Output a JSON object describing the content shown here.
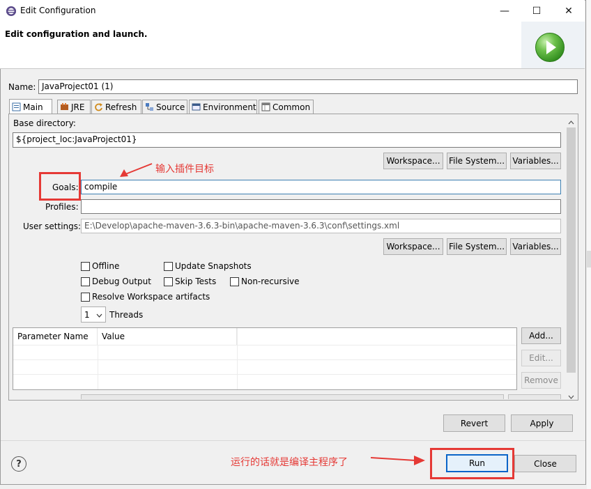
{
  "window": {
    "title": "Edit Configuration",
    "minimize_glyph": "—",
    "maximize_glyph": "☐",
    "close_glyph": "✕"
  },
  "header": {
    "title": "Edit configuration and launch.",
    "icon": "run-icon"
  },
  "name_field": {
    "label": "Name:",
    "value": "JavaProject01 (1)"
  },
  "tabs": [
    {
      "label": "Main",
      "icon": "main-tab-icon",
      "active": true
    },
    {
      "label": "JRE",
      "icon": "jre-icon"
    },
    {
      "label": "Refresh",
      "icon": "refresh-icon"
    },
    {
      "label": "Source",
      "icon": "source-icon"
    },
    {
      "label": "Environment",
      "icon": "environment-icon"
    },
    {
      "label": "Common",
      "icon": "common-icon"
    }
  ],
  "main": {
    "base_directory_label": "Base directory:",
    "base_directory_value": "${project_loc:JavaProject01}",
    "buttons_row1": [
      "Workspace...",
      "File System...",
      "Variables..."
    ],
    "goals_label": "Goals:",
    "goals_value": "compile",
    "profiles_label": "Profiles:",
    "profiles_value": "",
    "user_settings_label": "User settings:",
    "user_settings_value": "E:\\Develop\\apache-maven-3.6.3-bin\\apache-maven-3.6.3\\conf\\settings.xml",
    "buttons_row2": [
      "Workspace...",
      "File System...",
      "Variables..."
    ],
    "checkboxes": {
      "offline": "Offline",
      "update_snapshots": "Update Snapshots",
      "debug_output": "Debug Output",
      "skip_tests": "Skip Tests",
      "non_recursive": "Non-recursive",
      "resolve_workspace": "Resolve Workspace artifacts"
    },
    "threads_value": "1",
    "threads_label": "Threads",
    "table": {
      "columns": [
        "Parameter Name",
        "Value"
      ]
    },
    "table_buttons": {
      "add": "Add...",
      "edit": "Edit...",
      "remove": "Remove"
    }
  },
  "footer": {
    "revert": "Revert",
    "apply": "Apply",
    "run": "Run",
    "close": "Close",
    "help_glyph": "?"
  },
  "annotations": {
    "goals_note": "输入插件目标",
    "run_note": "运行的话就是编译主程序了"
  },
  "colors": {
    "annotation_red": "#e53935",
    "focus_blue": "#3c7fb1"
  }
}
